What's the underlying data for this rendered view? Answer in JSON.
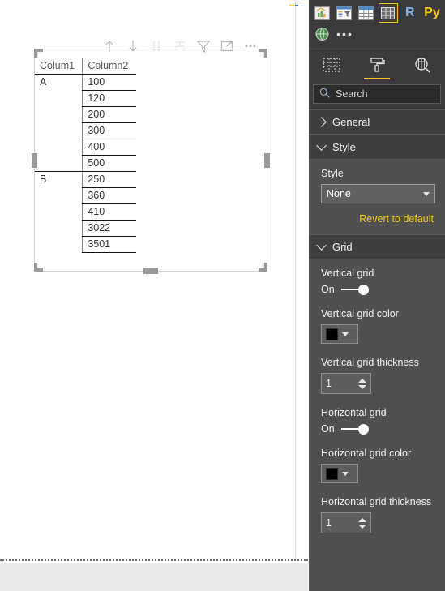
{
  "canvas": {
    "visual_toolbar": [
      {
        "name": "sort-ascending-icon",
        "label": "Expand up",
        "dimmed": false
      },
      {
        "name": "sort-descending-icon",
        "label": "Collapse down",
        "dimmed": false
      },
      {
        "name": "expand-all-down-icon",
        "label": "Expand all down",
        "dimmed": true
      },
      {
        "name": "drill-mode-icon",
        "label": "Drill mode",
        "dimmed": true
      },
      {
        "name": "filter-icon",
        "label": "Filters",
        "dimmed": false
      },
      {
        "name": "focus-mode-icon",
        "label": "Focus mode",
        "dimmed": false
      },
      {
        "name": "more-options-icon",
        "label": "More options",
        "dimmed": false
      }
    ],
    "table": {
      "headers": [
        "Colum1",
        "Column2"
      ],
      "rows": [
        {
          "group": "A",
          "value": "100"
        },
        {
          "group": "",
          "value": "120"
        },
        {
          "group": "",
          "value": "200"
        },
        {
          "group": "",
          "value": "300"
        },
        {
          "group": "",
          "value": "400"
        },
        {
          "group": "",
          "value": "500"
        },
        {
          "group": "B",
          "value": "250"
        },
        {
          "group": "",
          "value": "360"
        },
        {
          "group": "",
          "value": "410"
        },
        {
          "group": "",
          "value": "3022"
        },
        {
          "group": "",
          "value": "3501"
        }
      ]
    }
  },
  "panel": {
    "visualizations": {
      "row1": [
        {
          "name": "area-chart-icon",
          "type": "glyph"
        },
        {
          "name": "funnel-chart-icon",
          "type": "glyph"
        },
        {
          "name": "table-icon",
          "type": "glyph"
        },
        {
          "name": "matrix-icon",
          "type": "glyph",
          "selected": true
        },
        {
          "name": "r-script-visual-icon",
          "type": "letter",
          "text": "R"
        },
        {
          "name": "python-visual-icon",
          "type": "letter",
          "text": "Py"
        }
      ],
      "row2": [
        {
          "name": "map-globe-icon",
          "type": "glyph"
        },
        {
          "name": "more-visuals-icon",
          "type": "dots",
          "text": "•••"
        }
      ]
    },
    "tabs": [
      {
        "name": "tab-fields",
        "label": "Fields",
        "active": false
      },
      {
        "name": "tab-format",
        "label": "Format",
        "active": true
      },
      {
        "name": "tab-analytics",
        "label": "Analytics",
        "active": false
      }
    ],
    "search": {
      "placeholder": "Search",
      "value": "Search"
    },
    "sections": [
      {
        "name": "general",
        "title": "General",
        "expanded": false
      },
      {
        "name": "style",
        "title": "Style",
        "expanded": true,
        "style_label": "Style",
        "style_value": "None",
        "style_options": [
          "None"
        ],
        "revert_label": "Revert to default"
      },
      {
        "name": "grid",
        "title": "Grid",
        "expanded": true,
        "vertical_grid_label": "Vertical grid",
        "vertical_grid_state": "On",
        "vertical_grid_color_label": "Vertical grid color",
        "vertical_grid_color": "#000000",
        "vertical_grid_thickness_label": "Vertical grid thickness",
        "vertical_grid_thickness": "1",
        "horizontal_grid_label": "Horizontal grid",
        "horizontal_grid_state": "On",
        "horizontal_grid_color_label": "Horizontal grid color",
        "horizontal_grid_color": "#000000",
        "horizontal_grid_thickness_label": "Horizontal grid thickness",
        "horizontal_grid_thickness": "1"
      }
    ]
  },
  "colors": {
    "accent_yellow": "#f2c811",
    "panel_bg": "#505050",
    "panel_header_bg": "#3b3b3b",
    "section_head_bg": "#3f3f3f",
    "canvas_bg": "#ffffff",
    "footer_bg": "#e9e9e9"
  }
}
